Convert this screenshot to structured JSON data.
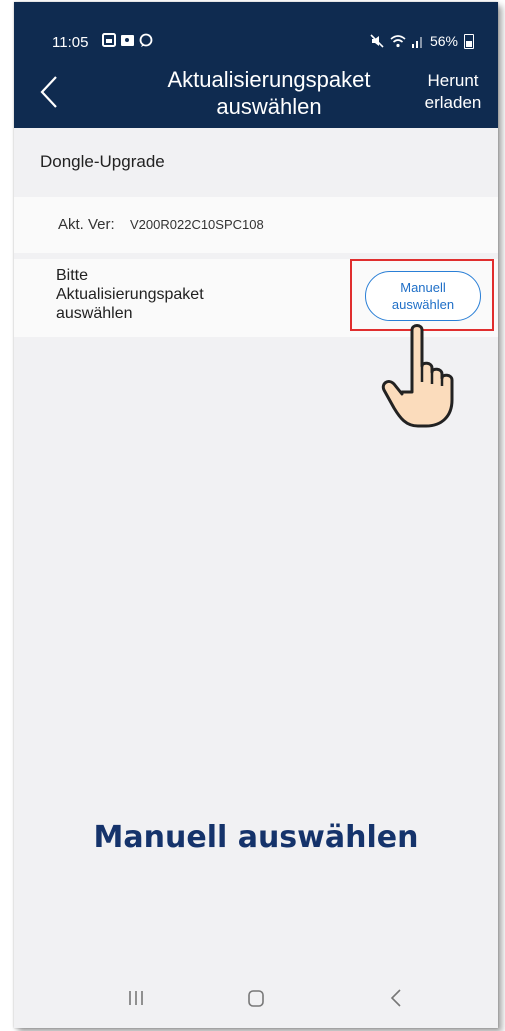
{
  "status_bar": {
    "time": "11:05",
    "left_icons": "▣ ◼ ○",
    "battery": "56%"
  },
  "header": {
    "title": "Aktualisierungspaket\nauswählen",
    "action_label": "Herunt\nerladen"
  },
  "content": {
    "section_title": "Dongle-Upgrade",
    "version_label": "Akt. Ver:",
    "version_value": "V200R022C10SPC108",
    "select_label": "Bitte\nAktualisierungspaket\nauswählen",
    "manual_button": "Manuell\nauswählen"
  },
  "caption": "Manuell auswählen",
  "colors": {
    "header_bg": "#0f2b50",
    "accent": "#2a7fd6",
    "highlight": "#e02e2e",
    "caption": "#15336b"
  },
  "icons": {
    "back": "chevron-left-icon",
    "hand": "pointing-hand-icon",
    "nav_recents": "recents-icon",
    "nav_home": "home-icon",
    "nav_back": "back-icon"
  }
}
